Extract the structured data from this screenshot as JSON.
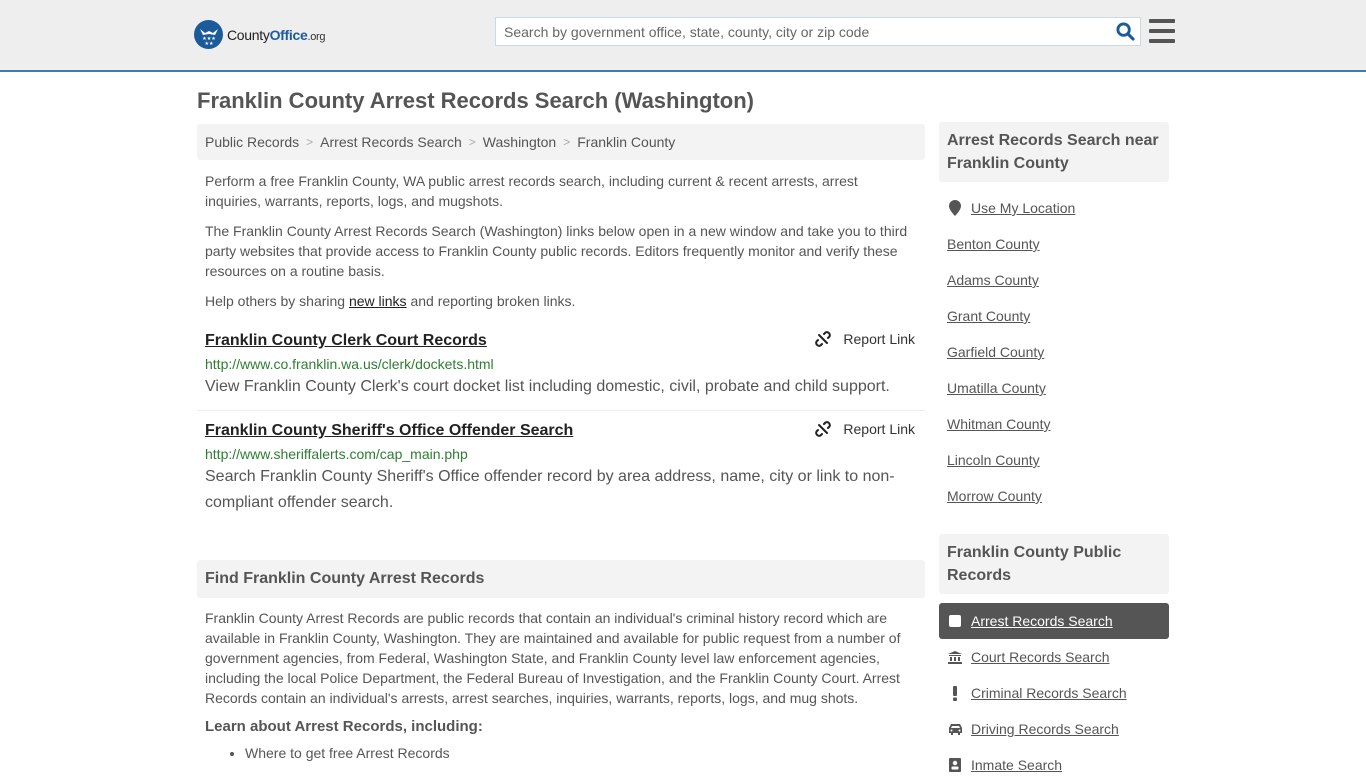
{
  "header": {
    "logo_name": "County",
    "logo_brand": "Office",
    "logo_tld": ".org",
    "search_placeholder": "Search by government office, state, county, city or zip code",
    "accent_color": "#1b5b9c"
  },
  "page_title": "Franklin County Arrest Records Search (Washington)",
  "breadcrumb": [
    {
      "label": "Public Records"
    },
    {
      "label": "Arrest Records Search"
    },
    {
      "label": "Washington"
    },
    {
      "label": "Franklin County"
    }
  ],
  "intro": {
    "p1": "Perform a free Franklin County, WA public arrest records search, including current & recent arrests, arrest inquiries, warrants, reports, logs, and mugshots.",
    "p2": "The Franklin County Arrest Records Search (Washington) links below open in a new window and take you to third party websites that provide access to Franklin County public records. Editors frequently monitor and verify these resources on a routine basis.",
    "p3_before": "Help others by sharing ",
    "p3_link": "new links",
    "p3_after": " and reporting broken links."
  },
  "results": [
    {
      "title": "Franklin County Clerk Court Records",
      "url": "http://www.co.franklin.wa.us/clerk/dockets.html",
      "description": "View Franklin County Clerk's court docket list including domestic, civil, probate and child support.",
      "report_label": "Report Link"
    },
    {
      "title": "Franklin County Sheriff's Office Offender Search",
      "url": "http://www.sheriffalerts.com/cap_main.php",
      "description": "Search Franklin County Sheriff's Office offender record by area address, name, city or link to non-compliant offender search.",
      "report_label": "Report Link"
    }
  ],
  "find_section": {
    "heading": "Find Franklin County Arrest Records",
    "body": "Franklin County Arrest Records are public records that contain an individual's criminal history record which are available in Franklin County, Washington. They are maintained and available for public request from a number of government agencies, from Federal, Washington State, and Franklin County level law enforcement agencies, including the local Police Department, the Federal Bureau of Investigation, and the Franklin County Court. Arrest Records contain an individual's arrests, arrest searches, inquiries, warrants, reports, logs, and mug shots.",
    "learn_heading": "Learn about Arrest Records, including:",
    "learn_items": [
      "Where to get free Arrest Records"
    ]
  },
  "sidebar": {
    "nearby_heading": "Arrest Records Search near Franklin County",
    "use_location": "Use My Location",
    "nearby": [
      "Benton County",
      "Adams County",
      "Grant County",
      "Garfield County",
      "Umatilla County",
      "Whitman County",
      "Lincoln County",
      "Morrow County"
    ],
    "public_records_heading": "Franklin County Public Records",
    "public_records": [
      {
        "label": "Arrest Records Search",
        "icon": "square-icon",
        "active": true
      },
      {
        "label": "Court Records Search",
        "icon": "courthouse-icon",
        "active": false
      },
      {
        "label": "Criminal Records Search",
        "icon": "exclamation-icon",
        "active": false
      },
      {
        "label": "Driving Records Search",
        "icon": "car-icon",
        "active": false
      },
      {
        "label": "Inmate Search",
        "icon": "inmate-icon",
        "active": false
      }
    ]
  }
}
